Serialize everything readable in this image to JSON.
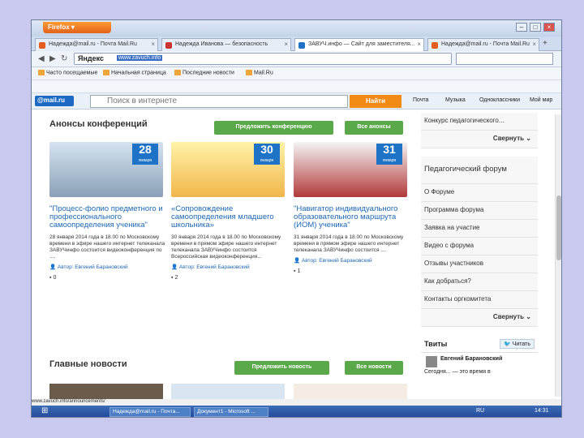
{
  "browser": {
    "menu_button": "Firefox",
    "tabs": [
      {
        "label": "Надежда@mail.ru - Почта Mail.Ru"
      },
      {
        "label": "Надежда Иванова — безопасность"
      },
      {
        "label": "ЗАВУЧ.инфо — Сайт для заместителя..."
      },
      {
        "label": "Надежда@mail.ru - Почта Mail.Ru"
      }
    ],
    "address_brand": "Яндекс",
    "url": "www.zavuch.info",
    "bookmarks": [
      "Часто посещаемые",
      "Начальная страница",
      "Последние новости",
      "Mail.Ru"
    ],
    "mail_toolbar": {
      "logo": "@mail.ru",
      "search_placeholder": "Поиск в интернете",
      "search_button": "Найти",
      "right_items": [
        "Почта",
        "Музыка",
        "Одноклассники",
        "Мой мир"
      ]
    }
  },
  "main": {
    "conferences_heading": "Анонсы конференций",
    "propose_conference_button": "Предложить конференцию",
    "all_announcements_button": "Все анонсы",
    "cards": [
      {
        "day": "28",
        "month": "января",
        "title": "\"Процесс-фолио предметного и профессионального самоопределения ученика\"",
        "desc": "28 января 2014 года в 18.00 по Московскому времени в эфире нашего интернет телеканала ЗАВУЧинфо состоится видеоконференция по ....",
        "author": "Автор: Евгений Барановский",
        "comments": "0"
      },
      {
        "day": "30",
        "month": "января",
        "title": "«Сопровождение самоопределения младшего школьника»",
        "desc": "30 января 2014 года в 18.00 по Московскому времени в прямом эфире нашего интернет телеканала ЗАВУЧинфо состоится Всероссийская видеоконференция...",
        "author": "Автор: Евгений Барановский",
        "comments": "2"
      },
      {
        "day": "31",
        "month": "января",
        "title": "\"Навигатор индивидуального образовательного маршрута (ИОМ) ученика\"",
        "desc": "31 января 2014 года в 18.00 по Московскому времени в прямом эфире нашего интернет телеканала ЗАВУЧинфо состоится ....",
        "author": "Автор: Евгений Барановский",
        "comments": "1"
      }
    ],
    "news_heading": "Главные новости",
    "propose_news_button": "Предложить новость",
    "all_news_button": "Все новости"
  },
  "sidebar": {
    "top_item": "Конкурс педагогического...",
    "collapse_label": "Свернуть",
    "forum_title": "Педагогический форум",
    "forum_items": [
      "О Форуме",
      "Программа форума",
      "Заявка на участие",
      "Видео с форума",
      "Отзывы участников",
      "Как добраться?",
      "Контакты оргкомитета"
    ],
    "tweets_title": "Твиты",
    "follow_button": "Читать",
    "tweet_author": "Евгений Барановский",
    "tweet_text": "Сегодня... — это время в"
  },
  "status_url": "www.zavuch.info/announcements/",
  "taskbar": {
    "items": [
      "Надежда@mail.ru - Почта...",
      "Документ1 - Microsoft ..."
    ],
    "lang": "RU",
    "clock": "14:31"
  },
  "colors": {
    "accent_blue": "#1e73c6",
    "green_button": "#5ba84b",
    "mail_orange": "#f28a16"
  }
}
